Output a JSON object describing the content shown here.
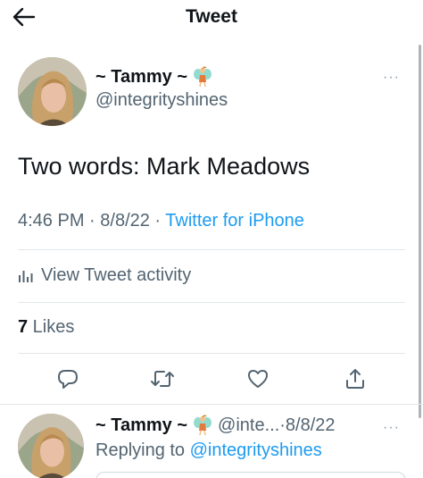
{
  "header": {
    "title": "Tweet",
    "back_icon": "arrow-left-icon"
  },
  "tweet": {
    "display_name": "~ Tammy ~",
    "name_emoji": "fairy-icon",
    "handle": "@integrityshines",
    "more": "···",
    "text": "Two words: Mark Meadows",
    "time": "4:46 PM",
    "sep1": " · ",
    "date": "8/8/22",
    "sep2": " · ",
    "source": "Twitter for iPhone",
    "activity_label": "View Tweet activity",
    "likes_count": "7",
    "likes_label": " Likes"
  },
  "actions": [
    "reply-icon",
    "retweet-icon",
    "like-icon",
    "share-icon"
  ],
  "reply": {
    "display_name": "~ Tammy ~",
    "handle_truncated": "@inte...",
    "sep": " · ",
    "date": "8/8/22",
    "more": "···",
    "replying_prefix": "Replying to ",
    "replying_to": "@integrityshines"
  },
  "colors": {
    "accent": "#1d9bf0",
    "secondary_text": "#536471",
    "primary_text": "#0f1419"
  }
}
